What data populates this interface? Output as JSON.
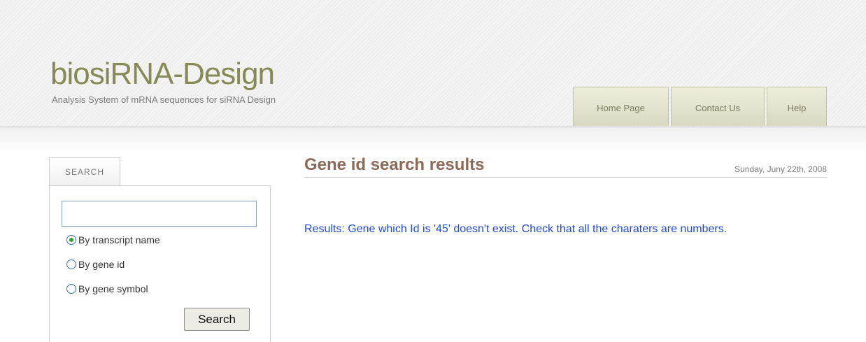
{
  "header": {
    "site_title": "biosiRNA-Design",
    "tagline": "Analysis System of mRNA sequences for siRNA Design"
  },
  "nav": {
    "items": [
      {
        "label": "Home Page"
      },
      {
        "label": "Contact Us"
      },
      {
        "label": "Help"
      }
    ]
  },
  "sidebar": {
    "tab_label": "SEARCH",
    "search_input_value": "",
    "options": [
      {
        "label": "By transcript name",
        "checked": true
      },
      {
        "label": "By gene id",
        "checked": false
      },
      {
        "label": "By gene symbol",
        "checked": false
      }
    ],
    "search_button_label": "Search"
  },
  "main": {
    "title": "Gene id search results",
    "date": "Sunday, Juny 22th, 2008",
    "result_text": "Results: Gene which Id is '45' doesn't exist. Check that all the charaters are numbers."
  },
  "colors": {
    "site_title": "#888a55",
    "page_title": "#8c6a58",
    "result_text": "#1f4ad8",
    "nav_tab": "#e4e4cf"
  }
}
